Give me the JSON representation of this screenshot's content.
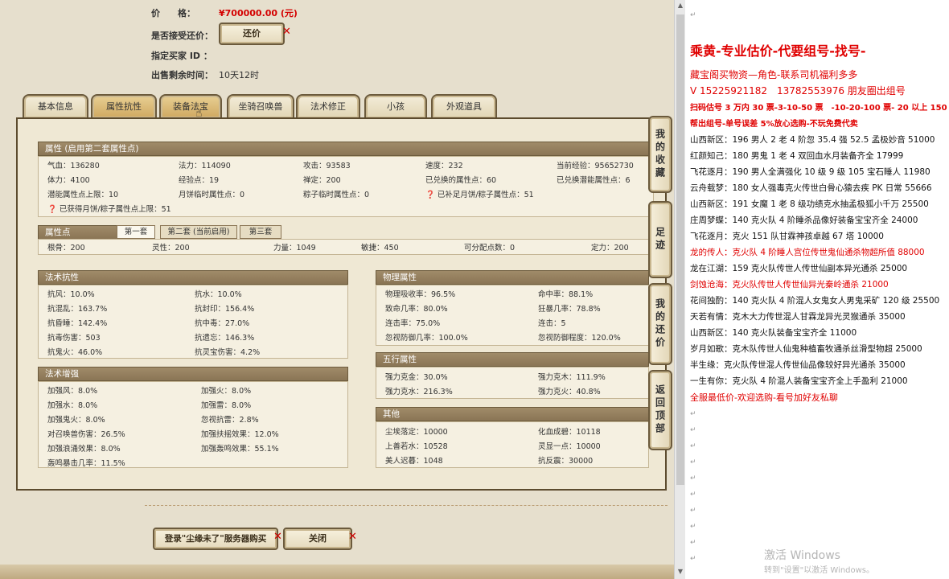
{
  "listing": {
    "price_label": "价　　格：",
    "price_value": "¥700000.00 (元)",
    "counter_label": "是否接受还价：",
    "counter_button": "还价",
    "buyer_label": "指定买家 ID ：",
    "remaining_label": "出售剩余时间：",
    "remaining_value": "10天12时"
  },
  "tabs": [
    "基本信息",
    "属性抗性",
    "装备法宝",
    "坐骑召唤兽",
    "法术修正",
    "小孩",
    "外观道具"
  ],
  "attr": {
    "title": "属性 (启用第二套属性点)",
    "rows": [
      [
        "气血：136280",
        "法力：114090",
        "攻击：93583",
        "速度：232",
        "当前经验：95652730"
      ],
      [
        "体力：4100",
        "经验点：19",
        "禅定：200",
        "已兑换的属性点：60",
        "已兑换潜能属性点：6"
      ],
      [
        "潜能属性点上限：10",
        "月饼临时属性点：0",
        "粽子临时属性点：0",
        "已补足月饼/粽子属性点：51"
      ]
    ],
    "moon_note": "已获得月饼/粽子属性点上限：51"
  },
  "points": {
    "title": "属性点",
    "subtabs": [
      "第一套",
      "第二套 (当前启用)",
      "第三套"
    ],
    "values": [
      "根骨：200",
      "灵性：200",
      "力量：1049",
      "敏捷：450",
      "可分配点数：0",
      "定力：200"
    ]
  },
  "spell_resist": {
    "title": "法术抗性",
    "cells": [
      "抗风：10.0%",
      "抗水：10.0%",
      "抗混乱：163.7%",
      "抗封印：156.4%",
      "抗昏睡：142.4%",
      "抗中毒：27.0%",
      "抗毒伤害：503",
      "抗遗忘：146.3%",
      "抗鬼火：46.0%",
      "抗灵宝伤害：4.2%"
    ]
  },
  "spell_boost": {
    "title": "法术增强",
    "cells": [
      "加强风：8.0%",
      "加强火：8.0%",
      "加强水：8.0%",
      "加强雷：8.0%",
      "加强鬼火：8.0%",
      "忽视抗雷：2.8%",
      "对召唤兽伤害：26.5%",
      "加强扶摇效果：12.0%",
      "加强浪涌效果：8.0%",
      "加强轰鸣效果：55.1%",
      "轰鸣暴击几率：11.5%"
    ]
  },
  "phys": {
    "title": "物理属性",
    "cells": [
      "物理吸收率：96.5%",
      "命中率：88.1%",
      "致命几率：80.0%",
      "狂暴几率：78.8%",
      "连击率：75.0%",
      "连击：5",
      "忽视防御几率：100.0%",
      "忽视防御程度：120.0%"
    ]
  },
  "wuxing": {
    "title": "五行属性",
    "cells": [
      "强力克金：30.0%",
      "强力克木：111.9%",
      "强力克水：216.3%",
      "强力克火：40.8%"
    ]
  },
  "other": {
    "title": "其他",
    "cells": [
      "尘埃落定：10000",
      "化血成碧：10118",
      "上善若水：10528",
      "灵显一点：10000",
      "美人迟暮：1048",
      "抗反震：30000"
    ]
  },
  "side_buttons": [
    "我的收藏",
    "足迹",
    "我的还价",
    "返回顶部"
  ],
  "bottom": {
    "login_button": "登录\"尘缘未了\"服务器购买",
    "close_button": "关闭"
  },
  "ad": {
    "title": "乘黄-专业估价-代要组号-找号-",
    "line2": "藏宝阁买物资—角色-联系司机福利多多",
    "line3": "V 15225921182　13782553976 朋友圈出组号",
    "line4": "扫码估号 3 万内 30 票-3-10-50 票　-10-20-100 票- 20 以上 150",
    "line5": "帮出组号-单号误差 5%放心选购-不玩免费代卖",
    "listings": [
      {
        "text": "山西新区：196 男人 2 老 4 阶忽 35.4 强 52.5 孟极妙音 51000",
        "red": false
      },
      {
        "text": "红颜知己：180 男鬼 1 老 4 双回血水月装备齐全 17999",
        "red": false
      },
      {
        "text": "飞花逐月：190 男人全满强化 10 级 9 级 105 宝石睡人 11980",
        "red": false
      },
      {
        "text": "云舟载梦：180 女人强毒克火传世白骨心猿去疾 PK 日常 55666",
        "red": false
      },
      {
        "text": "山西新区：191 女魔 1 老 8 级功绩克水抽孟极狐小千万 25500",
        "red": false
      },
      {
        "text": "庄周梦蝶：140 克火队 4 阶睡杀品像好装备宝宝齐全 24000",
        "red": false
      },
      {
        "text": "飞花逐月：克火 151 队甘霖神孩卓越 67 塔 10000",
        "red": false
      },
      {
        "text": "龙的传人：克火队 4 阶睡人宫位传世鬼仙通杀物超所值 88000",
        "red": true
      },
      {
        "text": "龙在江湖：159 克火队传世人传世仙副本异光通杀 25000",
        "red": false
      },
      {
        "text": "剑蚀沧海：克火队传世人传世仙异光秦岭通杀 21000",
        "red": true
      },
      {
        "text": "花间独酌：140 克火队 4 阶混人女鬼女人男鬼采矿 120 级 25500",
        "red": false
      },
      {
        "text": "天若有情：克木大力传世混人甘霖龙异光灵猴通杀 35000",
        "red": false
      },
      {
        "text": "山西新区：140 克火队装备宝宝齐全 11000",
        "red": false
      },
      {
        "text": "岁月如歌：克木队传世人仙鬼种植畜牧通杀丝滑型物超 25000",
        "red": false
      },
      {
        "text": "半生缘：克火队传世混人传世仙品像较好异光通杀 35000",
        "red": false
      },
      {
        "text": "一生有你：克火队 4 阶混人装备宝宝齐全上手盈利 21000",
        "red": false
      }
    ],
    "footer": "全服最低价-欢迎选购-看号加好友私聊"
  },
  "watermark": {
    "line1": "激活 Windows",
    "line2": "转到\"设置\"以激活 Windows。"
  }
}
